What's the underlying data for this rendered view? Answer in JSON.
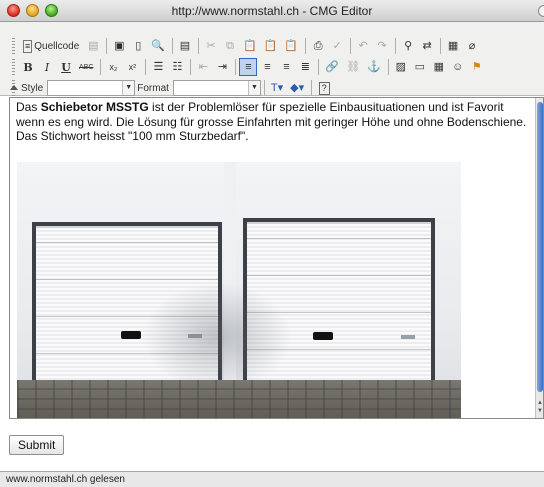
{
  "window": {
    "title": "http://www.normstahl.ch - CMG Editor"
  },
  "toolbar": {
    "row1": {
      "source_label": "Quellcode",
      "icons": [
        "source-icon",
        "templates-icon",
        "save-icon",
        "new-page-icon",
        "preview-icon",
        "paste-word-icon",
        "cut-icon",
        "copy-icon",
        "paste-icon",
        "paste-text-icon",
        "paste-from-word-icon",
        "print-icon",
        "spellcheck-icon",
        "undo-icon",
        "redo-icon",
        "find-icon",
        "replace-icon",
        "select-all-icon",
        "remove-format-icon"
      ]
    },
    "row2": {
      "bold": "B",
      "italic": "I",
      "underline": "U",
      "strike": "ABC",
      "subscript": "x₂",
      "superscript": "x²",
      "active": "justify-left"
    },
    "row3": {
      "style_label": "Style",
      "style_value": "",
      "format_label": "Format",
      "format_value": ""
    }
  },
  "editor": {
    "intro_before": "Das ",
    "product_name": "Schiebetor MSSTG",
    "intro_after": " ist der Problemlöser für spezielle Einbausituationen und ist Favorit wenn es eng wird. Die Lösung für grosse Einfahrten mit geringer Höhe und ohne Bodenschiene. Das Stichwort heisst \"100 mm Sturzbedarf\".",
    "image_subject": "two-white-garage-doors"
  },
  "form": {
    "submit_label": "Submit"
  },
  "status": {
    "text": "www.normstahl.ch gelesen"
  }
}
